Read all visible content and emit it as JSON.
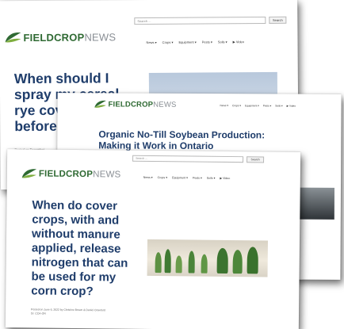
{
  "screenshots": {
    "back": {
      "search_placeholder": "Search ...",
      "search_button": "Search",
      "logo": {
        "bold": "FIELDCROP",
        "light": "NEWS"
      },
      "nav": [
        "News ▾",
        "Crops ▾",
        "Equipment ▾",
        "Pests ▾",
        "Soils ▾",
        "▶ Video"
      ],
      "title_lines": [
        "When should I",
        "spray my cereal",
        "rye cover crop",
        "before"
      ],
      "byline": "Posted on December..."
    },
    "mid": {
      "logo": {
        "bold": "FIELDCROP",
        "light": "NEWS"
      },
      "nav": [
        "News ▾",
        "Crops ▾",
        "Equipment ▾",
        "Pests ▾",
        "Soils ▾",
        "▶ Video"
      ],
      "title_lines": [
        "Organic No-Till Soybean Production:",
        "Making it Work in Ontario"
      ]
    },
    "front": {
      "search_placeholder": "Search ...",
      "search_button": "Search",
      "logo": {
        "bold": "FIELDCROP",
        "light": "NEWS"
      },
      "nav": [
        "News ▾",
        "Crops ▾",
        "Equipment ▾",
        "Pests ▾",
        "Soils ▾",
        "▶ Video"
      ],
      "title_lines": [
        "When do cover",
        "crops, with and",
        "without manure",
        "applied, release",
        "nitrogen that can",
        "be used for my",
        "corn crop?"
      ],
      "byline_lines": [
        "Posted on June 6, 2022 by Christine Brown & Daniel Crawford",
        "Dr. CCA-ON"
      ]
    }
  },
  "colors": {
    "brand_green": "#2f6a33",
    "logo_grey": "#8a8f95",
    "title_blue": "#1f3d6b"
  }
}
